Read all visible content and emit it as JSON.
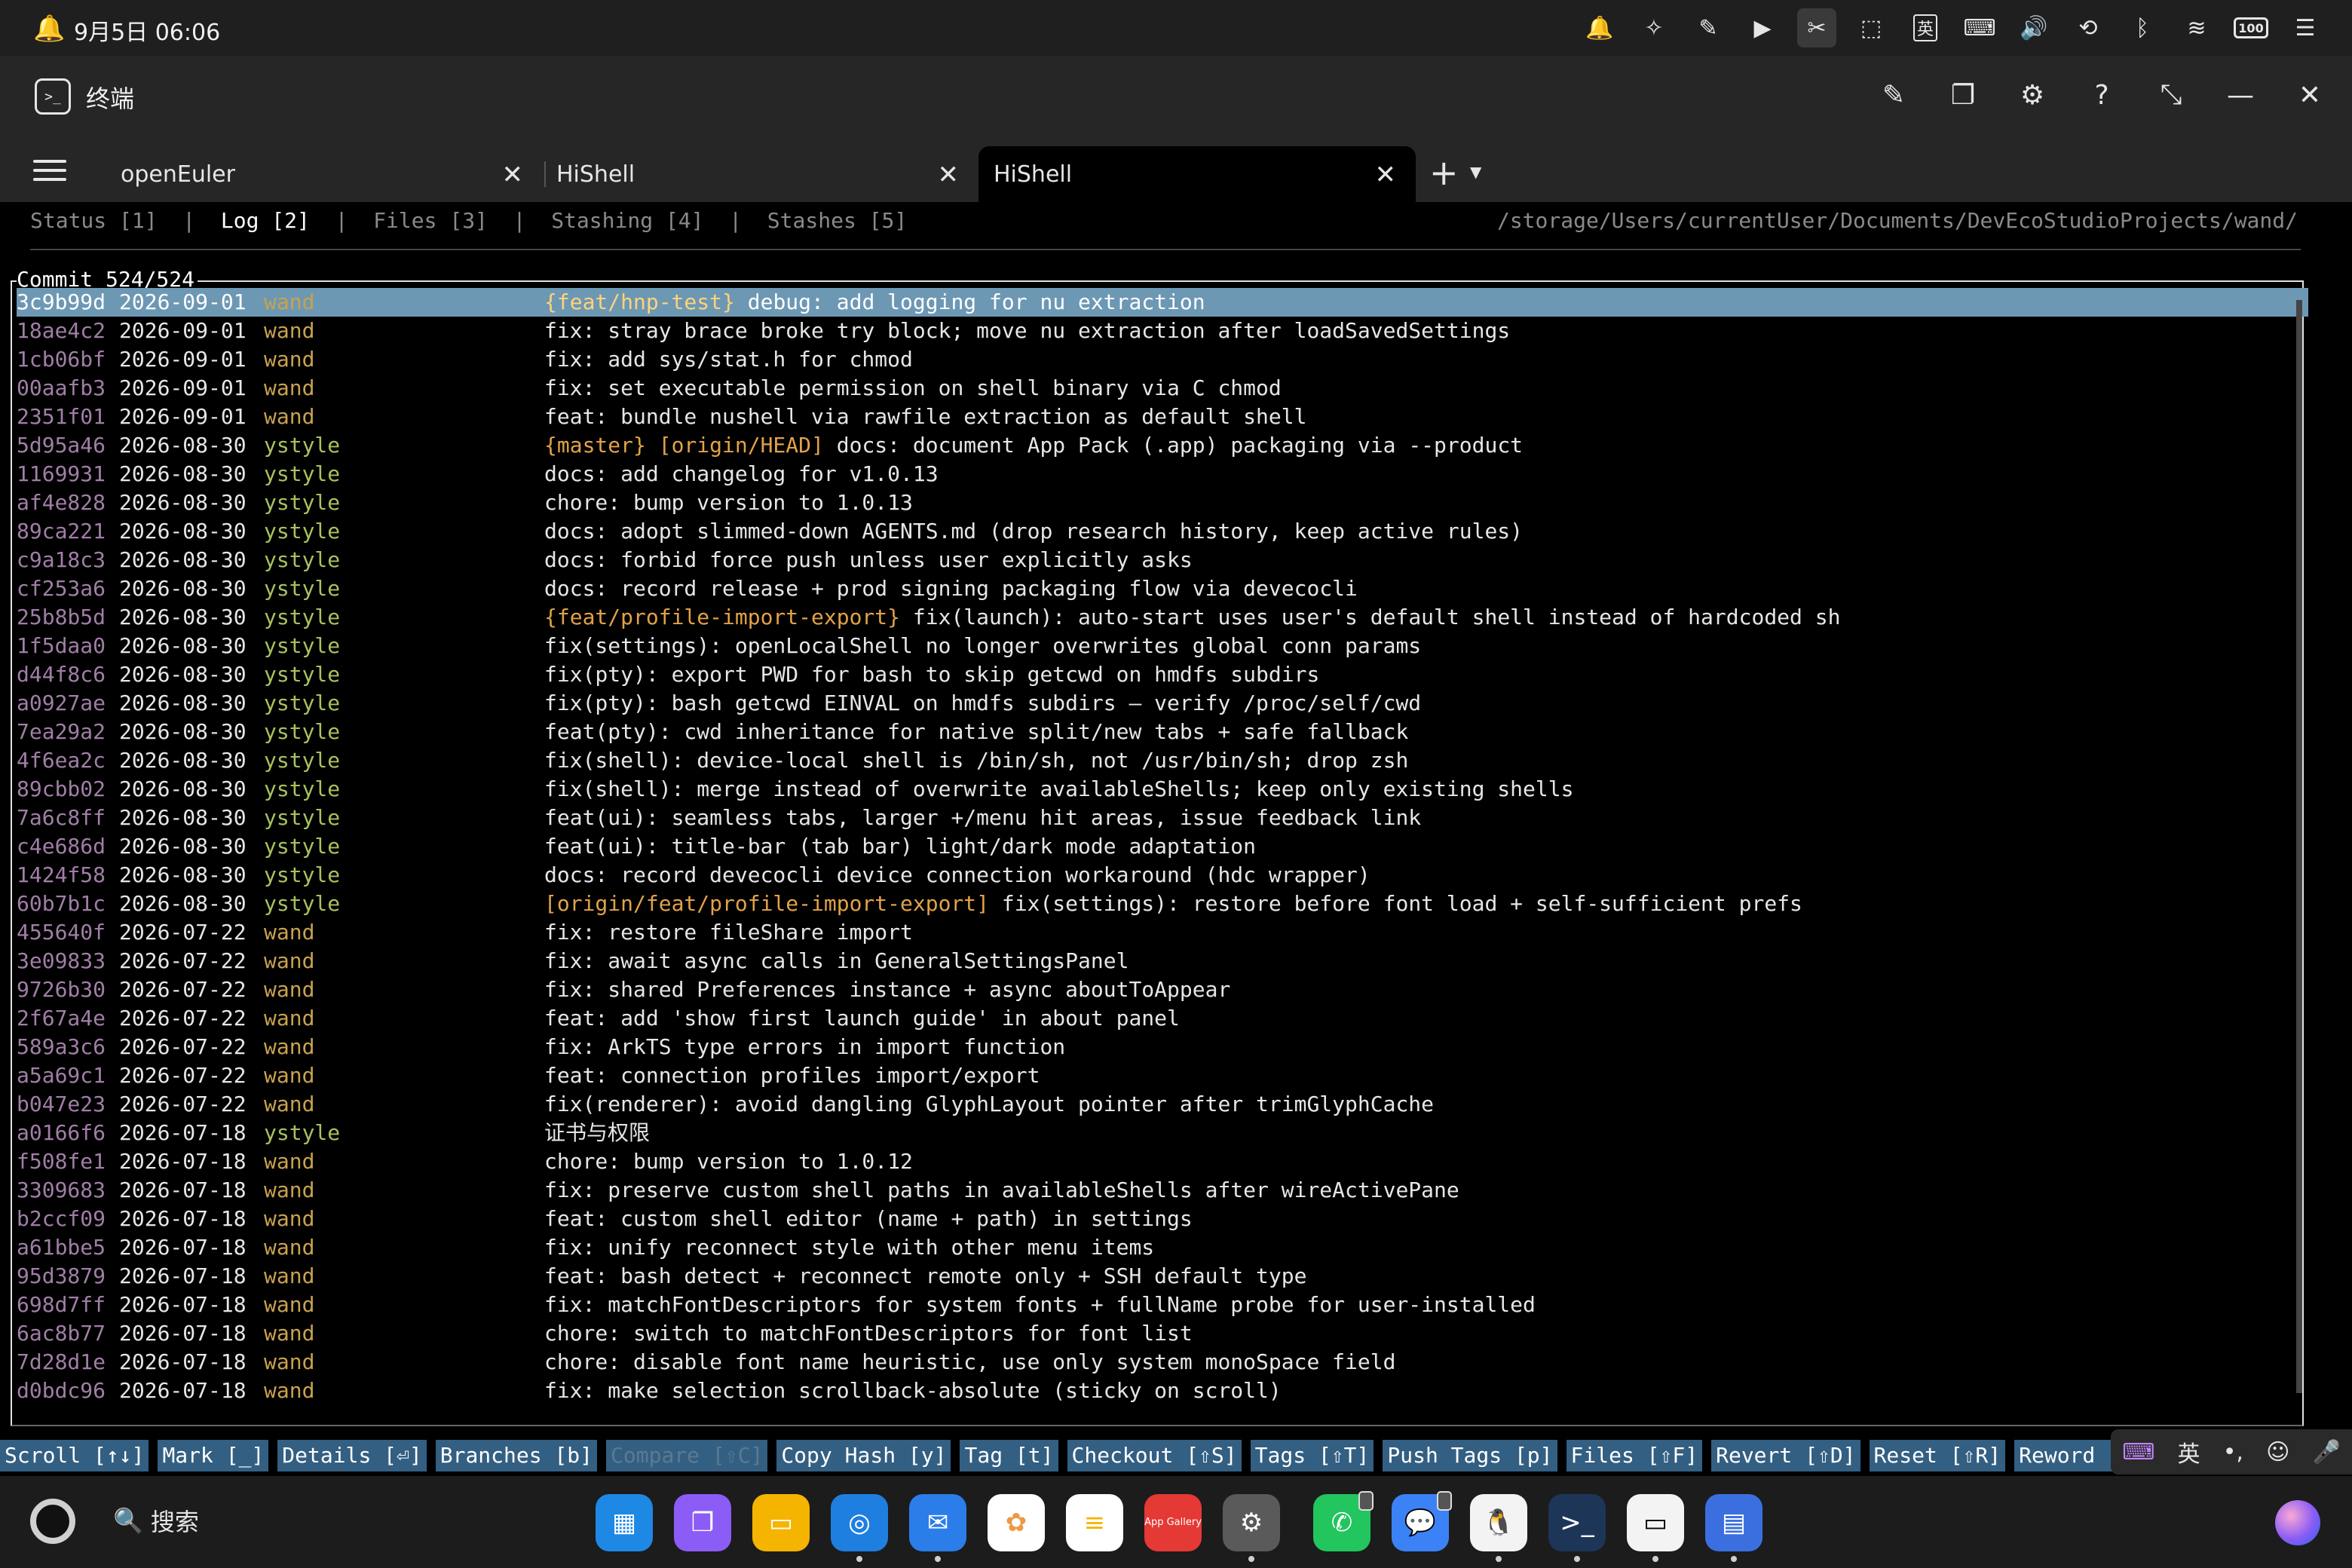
{
  "statusbar": {
    "time": "9月5日 06:06",
    "ime_label": "英",
    "battery": "100"
  },
  "titlebar": {
    "app_icon": ">_",
    "title": "终端"
  },
  "tabs": [
    {
      "label": "openEuler"
    },
    {
      "label": "HiShell"
    },
    {
      "label": "HiShell"
    }
  ],
  "terminal": {
    "nav": {
      "status": "Status [1]",
      "log": "Log [2]",
      "files": "Files [3]",
      "stashing": "Stashing [4]",
      "stashes": "Stashes [5]",
      "sep": "|"
    },
    "path": "/storage/Users/currentUser/Documents/DevEcoStudioProjects/wand/",
    "panel_title": "Commit 524/524",
    "commits": [
      {
        "hash": "3c9b99d",
        "date": "2026-09-01",
        "author": "wand",
        "ref": "{feat/hnp-test}",
        "msg": "debug: add logging for nu extraction"
      },
      {
        "hash": "18ae4c2",
        "date": "2026-09-01",
        "author": "wand",
        "ref": "",
        "msg": "fix: stray brace broke try block; move nu extraction after loadSavedSettings"
      },
      {
        "hash": "1cb06bf",
        "date": "2026-09-01",
        "author": "wand",
        "ref": "",
        "msg": "fix: add sys/stat.h for chmod"
      },
      {
        "hash": "00aafb3",
        "date": "2026-09-01",
        "author": "wand",
        "ref": "",
        "msg": "fix: set executable permission on shell binary via C chmod"
      },
      {
        "hash": "2351f01",
        "date": "2026-09-01",
        "author": "wand",
        "ref": "",
        "msg": "feat: bundle nushell via rawfile extraction as default shell"
      },
      {
        "hash": "5d95a46",
        "date": "2026-08-30",
        "author": "ystyle",
        "ref": "{master} [origin/HEAD]",
        "msg": "docs: document App Pack (.app) packaging via --product"
      },
      {
        "hash": "1169931",
        "date": "2026-08-30",
        "author": "ystyle",
        "ref": "",
        "msg": "docs: add changelog for v1.0.13"
      },
      {
        "hash": "af4e828",
        "date": "2026-08-30",
        "author": "ystyle",
        "ref": "",
        "msg": "chore: bump version to 1.0.13"
      },
      {
        "hash": "89ca221",
        "date": "2026-08-30",
        "author": "ystyle",
        "ref": "",
        "msg": "docs: adopt slimmed-down AGENTS.md (drop research history, keep active rules)"
      },
      {
        "hash": "c9a18c3",
        "date": "2026-08-30",
        "author": "ystyle",
        "ref": "",
        "msg": "docs: forbid force push unless user explicitly asks"
      },
      {
        "hash": "cf253a6",
        "date": "2026-08-30",
        "author": "ystyle",
        "ref": "",
        "msg": "docs: record release + prod signing packaging flow via devecocli"
      },
      {
        "hash": "25b8b5d",
        "date": "2026-08-30",
        "author": "ystyle",
        "ref": "{feat/profile-import-export}",
        "msg": "fix(launch): auto-start uses user's default shell instead of hardcoded sh"
      },
      {
        "hash": "1f5daa0",
        "date": "2026-08-30",
        "author": "ystyle",
        "ref": "",
        "msg": "fix(settings): openLocalShell no longer overwrites global conn params"
      },
      {
        "hash": "d44f8c6",
        "date": "2026-08-30",
        "author": "ystyle",
        "ref": "",
        "msg": "fix(pty): export PWD for bash to skip getcwd on hmdfs subdirs"
      },
      {
        "hash": "a0927ae",
        "date": "2026-08-30",
        "author": "ystyle",
        "ref": "",
        "msg": "fix(pty): bash getcwd EINVAL on hmdfs subdirs — verify /proc/self/cwd"
      },
      {
        "hash": "7ea29a2",
        "date": "2026-08-30",
        "author": "ystyle",
        "ref": "",
        "msg": "feat(pty): cwd inheritance for native split/new tabs + safe fallback"
      },
      {
        "hash": "4f6ea2c",
        "date": "2026-08-30",
        "author": "ystyle",
        "ref": "",
        "msg": "fix(shell): device-local shell is /bin/sh, not /usr/bin/sh; drop zsh"
      },
      {
        "hash": "89cbb02",
        "date": "2026-08-30",
        "author": "ystyle",
        "ref": "",
        "msg": "fix(shell): merge instead of overwrite availableShells; keep only existing shells"
      },
      {
        "hash": "7a6c8ff",
        "date": "2026-08-30",
        "author": "ystyle",
        "ref": "",
        "msg": "feat(ui): seamless tabs, larger +/menu hit areas, issue feedback link"
      },
      {
        "hash": "c4e686d",
        "date": "2026-08-30",
        "author": "ystyle",
        "ref": "",
        "msg": "feat(ui): title-bar (tab bar) light/dark mode adaptation"
      },
      {
        "hash": "1424f58",
        "date": "2026-08-30",
        "author": "ystyle",
        "ref": "",
        "msg": "docs: record devecocli device connection workaround (hdc wrapper)"
      },
      {
        "hash": "60b7b1c",
        "date": "2026-08-30",
        "author": "ystyle",
        "ref": "[origin/feat/profile-import-export]",
        "msg": "fix(settings): restore before font load + self-sufficient prefs"
      },
      {
        "hash": "455640f",
        "date": "2026-07-22",
        "author": "wand",
        "ref": "",
        "msg": "fix: restore fileShare import"
      },
      {
        "hash": "3e09833",
        "date": "2026-07-22",
        "author": "wand",
        "ref": "",
        "msg": "fix: await async calls in GeneralSettingsPanel"
      },
      {
        "hash": "9726b30",
        "date": "2026-07-22",
        "author": "wand",
        "ref": "",
        "msg": "fix: shared Preferences instance + async aboutToAppear"
      },
      {
        "hash": "2f67a4e",
        "date": "2026-07-22",
        "author": "wand",
        "ref": "",
        "msg": "feat: add 'show first launch guide' in about panel"
      },
      {
        "hash": "589a3c6",
        "date": "2026-07-22",
        "author": "wand",
        "ref": "",
        "msg": "fix: ArkTS type errors in import function"
      },
      {
        "hash": "a5a69c1",
        "date": "2026-07-22",
        "author": "wand",
        "ref": "",
        "msg": "feat: connection profiles import/export"
      },
      {
        "hash": "b047e23",
        "date": "2026-07-22",
        "author": "wand",
        "ref": "",
        "msg": "fix(renderer): avoid dangling GlyphLayout pointer after trimGlyphCache"
      },
      {
        "hash": "a0166f6",
        "date": "2026-07-18",
        "author": "ystyle",
        "ref": "",
        "msg": "证书与权限"
      },
      {
        "hash": "f508fe1",
        "date": "2026-07-18",
        "author": "wand",
        "ref": "",
        "msg": "chore: bump version to 1.0.12"
      },
      {
        "hash": "3309683",
        "date": "2026-07-18",
        "author": "wand",
        "ref": "",
        "msg": "fix: preserve custom shell paths in availableShells after wireActivePane"
      },
      {
        "hash": "b2ccf09",
        "date": "2026-07-18",
        "author": "wand",
        "ref": "",
        "msg": "feat: custom shell editor (name + path) in settings"
      },
      {
        "hash": "a61bbe5",
        "date": "2026-07-18",
        "author": "wand",
        "ref": "",
        "msg": "fix: unify reconnect style with other menu items"
      },
      {
        "hash": "95d3879",
        "date": "2026-07-18",
        "author": "wand",
        "ref": "",
        "msg": "feat: bash detect + reconnect remote only + SSH default type"
      },
      {
        "hash": "698d7ff",
        "date": "2026-07-18",
        "author": "wand",
        "ref": "",
        "msg": "fix: matchFontDescriptors for system fonts + fullName probe for user-installed"
      },
      {
        "hash": "6ac8b77",
        "date": "2026-07-18",
        "author": "wand",
        "ref": "",
        "msg": "chore: switch to matchFontDescriptors for font list"
      },
      {
        "hash": "7d28d1e",
        "date": "2026-07-18",
        "author": "wand",
        "ref": "",
        "msg": "chore: disable font name heuristic, use only system monoSpace field"
      },
      {
        "hash": "d0bdc96",
        "date": "2026-07-18",
        "author": "wand",
        "ref": "",
        "msg": "fix: make selection scrollback-absolute (sticky on scroll)"
      }
    ],
    "author_colors": {
      "wand": "#c9a24e",
      "ystyle": "#a8c25c"
    },
    "hints": [
      {
        "label": "Scroll [↑↓]",
        "enabled": true
      },
      {
        "label": "Mark [_]",
        "enabled": true
      },
      {
        "label": "Details [⏎]",
        "enabled": true
      },
      {
        "label": "Branches [b]",
        "enabled": true
      },
      {
        "label": "Compare [⇧C]",
        "enabled": false
      },
      {
        "label": "Copy Hash [y]",
        "enabled": true
      },
      {
        "label": "Tag [t]",
        "enabled": true
      },
      {
        "label": "Checkout [⇧S]",
        "enabled": true
      },
      {
        "label": "Tags [⇧T]",
        "enabled": true
      },
      {
        "label": "Push Tags [p]",
        "enabled": true
      },
      {
        "label": "Files [⇧F]",
        "enabled": true
      },
      {
        "label": "Revert [⇧D]",
        "enabled": true
      },
      {
        "label": "Reset [⇧R]",
        "enabled": true
      },
      {
        "label": "Reword [r]",
        "enabled": true
      }
    ]
  },
  "ime_toolbar": {
    "lang": "英"
  },
  "dock": {
    "search_label": "搜索",
    "gallery_label": "App Gallery"
  }
}
